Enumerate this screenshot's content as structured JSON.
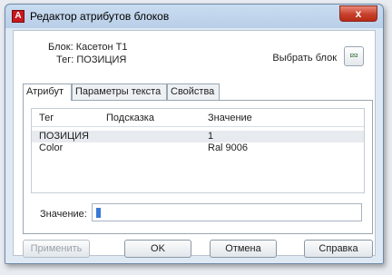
{
  "window": {
    "title": "Редактор атрибутов блоков",
    "close_label": "x",
    "app_icon_letter": "A"
  },
  "info": {
    "block_label": "Блок:",
    "block_value": "Касетон Т1",
    "tag_label": "Тег:",
    "tag_value": "ПОЗИЦИЯ",
    "pick_block_label": "Выбрать блок"
  },
  "tabs": [
    {
      "label": "Атрибут"
    },
    {
      "label": "Параметры текста"
    },
    {
      "label": "Свойства"
    }
  ],
  "grid": {
    "columns": [
      "Тег",
      "Подсказка",
      "Значение"
    ],
    "rows": [
      {
        "tag": "ПОЗИЦИЯ",
        "prompt": "",
        "value": "1"
      },
      {
        "tag": "Color",
        "prompt": "",
        "value": "Ral 9006"
      }
    ]
  },
  "value_field": {
    "label": "Значение:",
    "value": "1"
  },
  "buttons": {
    "apply": "Применить",
    "ok": "OK",
    "cancel": "Отмена",
    "help": "Справка"
  },
  "colors": {
    "title_gradient": "#b9cfe8",
    "close_button": "#c7402b",
    "selected_row": "#e7eaee"
  },
  "icons": {
    "pick_block": "pick-block-icon",
    "app": "autocad-icon"
  }
}
